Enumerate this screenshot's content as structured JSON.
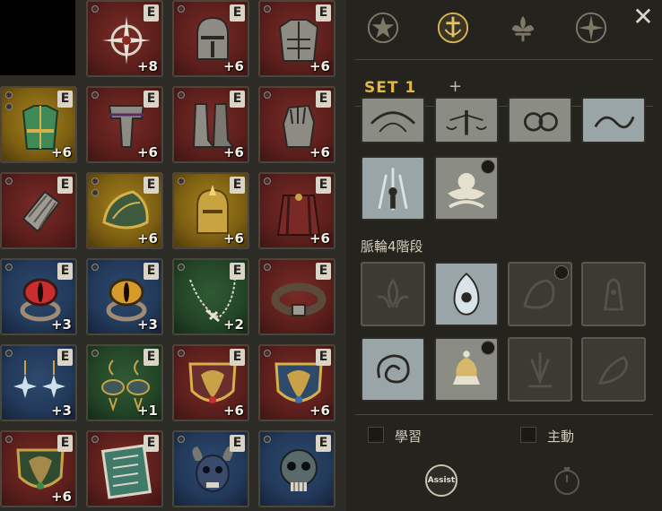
{
  "inventory": {
    "enhance_badge": "E",
    "slots": [
      {
        "name": "compass-amulet",
        "plus": "+8"
      },
      {
        "name": "knight-helmet",
        "plus": "+6"
      },
      {
        "name": "plate-chest-armor",
        "plus": "+6"
      },
      {
        "name": "green-tunic",
        "plus": "+6"
      },
      {
        "name": "plate-leg-armor",
        "plus": "+6"
      },
      {
        "name": "plate-boots",
        "plus": "+6"
      },
      {
        "name": "plate-gauntlets",
        "plus": "+6"
      },
      {
        "name": "bracer",
        "plus": ""
      },
      {
        "name": "gold-shoulder-guard",
        "plus": "+6"
      },
      {
        "name": "gold-helmet",
        "plus": "+6"
      },
      {
        "name": "red-cloak",
        "plus": "+6"
      },
      {
        "name": "red-eye-ring",
        "plus": "+3"
      },
      {
        "name": "gold-eye-ring",
        "plus": "+3"
      },
      {
        "name": "silver-necklace",
        "plus": "+2"
      },
      {
        "name": "leather-belt",
        "plus": ""
      },
      {
        "name": "star-earrings",
        "plus": "+3"
      },
      {
        "name": "eye-earrings",
        "plus": "+1"
      },
      {
        "name": "red-emblem",
        "plus": "+6"
      },
      {
        "name": "blue-emblem",
        "plus": "+6"
      },
      {
        "name": "green-emblem",
        "plus": "+6"
      },
      {
        "name": "rune-tablet",
        "plus": ""
      },
      {
        "name": "beast-skull-item",
        "plus": ""
      },
      {
        "name": "skull-item",
        "plus": ""
      }
    ]
  },
  "panel": {
    "tabs": [
      "star-emblem-icon",
      "sword-emblem-icon",
      "fleur-icon",
      "compass-icon"
    ],
    "set_label": "SET 1",
    "add_symbol": "+",
    "close_symbol": "✕",
    "tier_label": "脈輪4階段",
    "checkbox_learn": "學習",
    "checkbox_auto": "主動",
    "assist_label": "Assist"
  },
  "colors": {
    "accent_gold": "#e0b84a",
    "slot_red": "#5c1f1c",
    "slot_gold": "#7d5f12",
    "slot_blue": "#22395a",
    "slot_green": "#234527"
  }
}
